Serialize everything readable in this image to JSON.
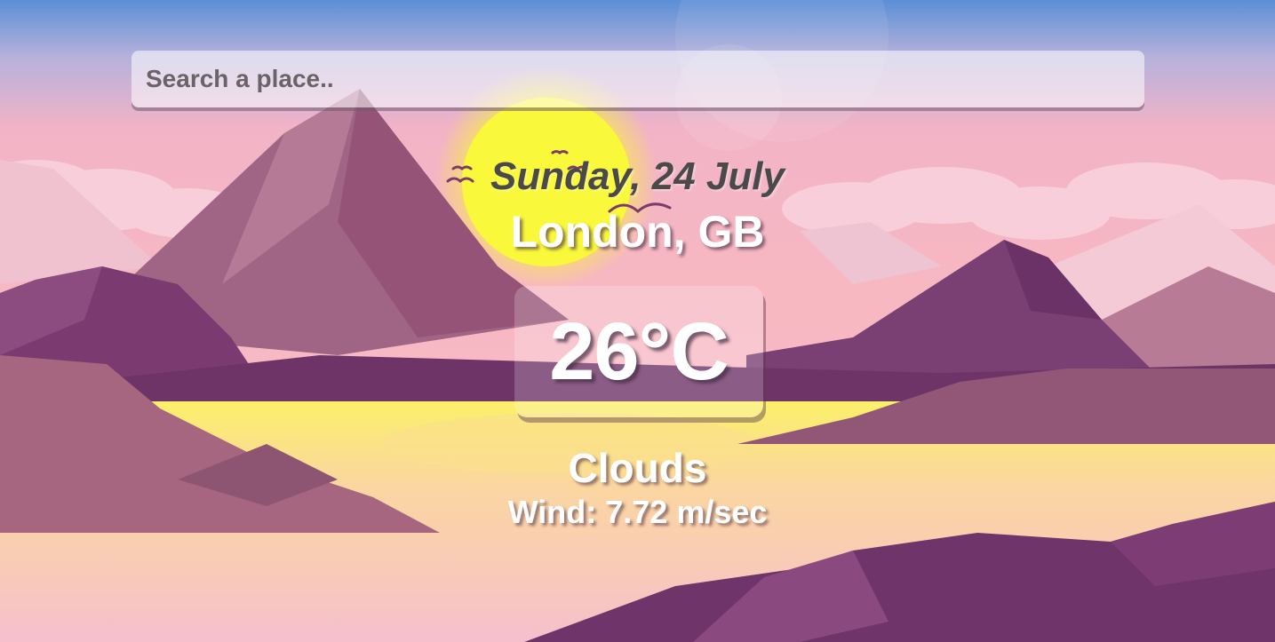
{
  "search": {
    "placeholder": "Search a place.."
  },
  "weather": {
    "date": "Sunday, 24 July",
    "location": "London, GB",
    "temperature": "26°C",
    "condition": "Clouds",
    "wind": "Wind: 7.72 m/sec"
  },
  "colors": {
    "sky_top": "#5b8fd6",
    "sky_mid": "#f4b6c4",
    "sun": "#f8f536",
    "mountain_dark": "#6e3569",
    "mountain_mid": "#9b5a7d",
    "water": "#f6c1cc"
  }
}
